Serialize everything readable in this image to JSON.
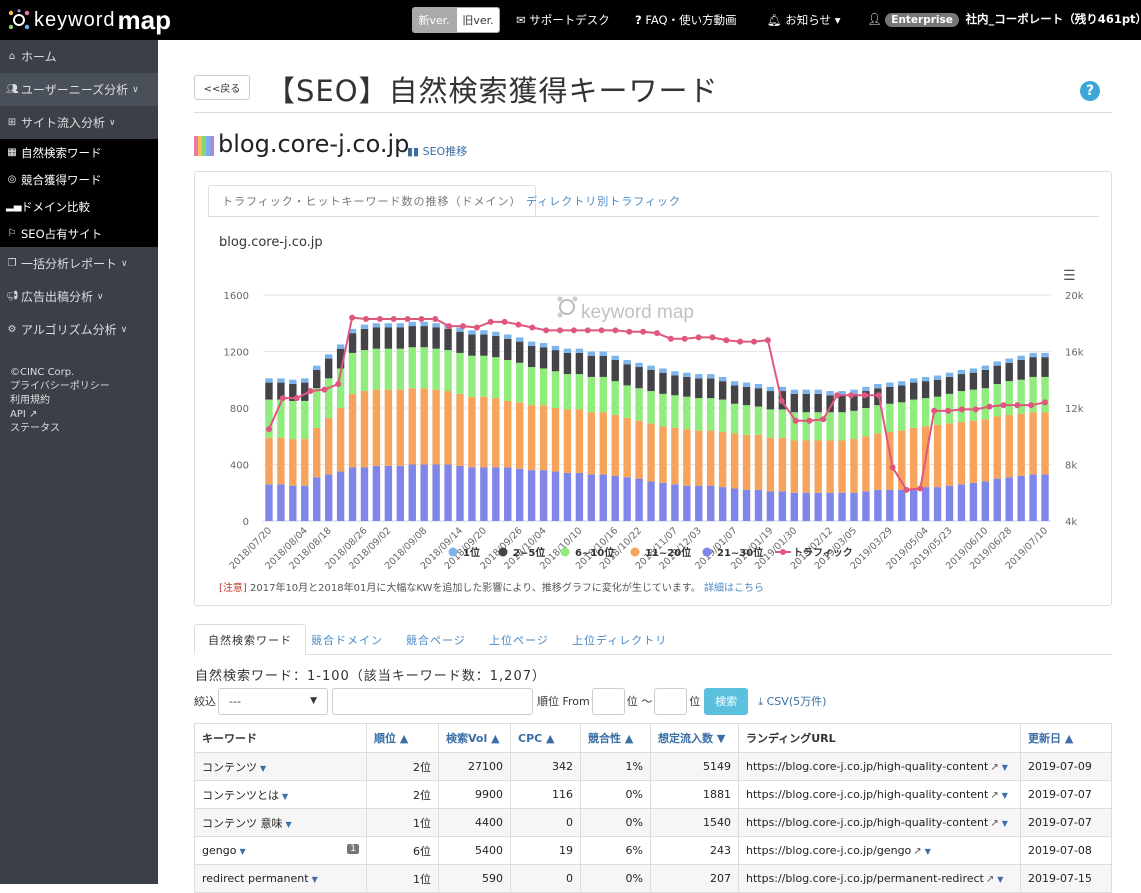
{
  "topbar": {
    "logo_keyword": "keyword",
    "logo_map": "map",
    "new_version": "新ver.",
    "old_version": "旧ver.",
    "support": "サポートデスク",
    "faq": "FAQ・使い方動画",
    "notice": "お知らせ",
    "plan_badge": "Enterprise",
    "account": "社内_コーポレート（残り461pt）"
  },
  "sidebar": {
    "items": [
      {
        "label": "ホーム",
        "icon": "home-icon"
      },
      {
        "label": "ユーザーニーズ分析",
        "icon": "users-icon"
      },
      {
        "label": "サイト流入分析",
        "icon": "sitemap-icon"
      }
    ],
    "subitems": [
      {
        "label": "自然検索ワード",
        "icon": "table-icon"
      },
      {
        "label": "競合獲得ワード",
        "icon": "target-icon"
      },
      {
        "label": "ドメイン比較",
        "icon": "signal-icon"
      },
      {
        "label": "SEO占有サイト",
        "icon": "flag-icon"
      }
    ],
    "items2": [
      {
        "label": "一括分析レポート",
        "icon": "copy-icon"
      },
      {
        "label": "広告出稿分析",
        "icon": "bullhorn-icon"
      },
      {
        "label": "アルゴリズム分析",
        "icon": "cogs-icon"
      }
    ],
    "footer": {
      "copyright": "©CINC Corp.",
      "privacy": "プライバシーポリシー",
      "terms": "利用規約",
      "api": "API",
      "status": "ステータス"
    }
  },
  "page": {
    "back_label": "<<戻る",
    "title": "【SEO】自然検索獲得キーワード",
    "help": "?",
    "domain": "blog.core-j.co.jp",
    "seo_link": "SEO推移"
  },
  "chart_tabs": {
    "tab1": "トラフィック・ヒットキーワード数の推移（ドメイン）",
    "tab2": "ディレクトリ別トラフィック"
  },
  "chart_data": {
    "type": "bar",
    "title": "blog.core-j.co.jp",
    "watermark": "keyword map",
    "stacked": true,
    "y_left_ticks": [
      "0",
      "400",
      "800",
      "1200",
      "1600"
    ],
    "y_right_ticks": [
      "4k",
      "8k",
      "12k",
      "16k",
      "20k"
    ],
    "ylim": [
      0,
      1600
    ],
    "y2lim": [
      4000,
      20000
    ],
    "x_ticks": [
      "2018/07/20",
      "2018/08/04",
      "2018/08/18",
      "2018/08/26",
      "2018/09/02",
      "2018/09/08",
      "2018/09/14",
      "2018/09/20",
      "2018/09/26",
      "2018/10/04",
      "2018/10/10",
      "2018/10/16",
      "2018/10/22",
      "2018/11/07",
      "2018/12/03",
      "2019/01/07",
      "2019/01/19",
      "2019/01/30",
      "2019/02/12",
      "2019/03/05",
      "2019/03/29",
      "2019/05/04",
      "2019/05/23",
      "2019/06/10",
      "2019/06/28",
      "2019/07/10"
    ],
    "series": [
      {
        "name": "1位",
        "color": "#7cb5ec",
        "values": [
          30,
          30,
          30,
          30,
          30,
          30,
          30,
          30,
          30,
          30,
          30,
          30,
          30,
          30,
          30,
          30,
          30,
          30,
          30,
          30,
          30,
          30,
          30,
          30,
          30,
          30,
          30,
          30,
          30,
          30,
          30,
          30,
          30,
          30,
          30,
          30,
          30,
          30,
          30,
          30,
          30,
          30,
          30,
          30,
          30,
          30,
          30,
          30,
          30,
          30,
          30,
          30,
          30,
          30,
          30,
          30,
          30,
          30,
          30,
          30,
          30,
          30,
          30,
          30,
          30,
          30
        ]
      },
      {
        "name": "2~5位",
        "color": "#434348",
        "values": [
          120,
          120,
          120,
          130,
          130,
          140,
          140,
          140,
          150,
          150,
          150,
          150,
          150,
          150,
          150,
          150,
          150,
          150,
          150,
          150,
          150,
          150,
          150,
          150,
          150,
          150,
          150,
          150,
          150,
          150,
          150,
          150,
          150,
          150,
          140,
          140,
          140,
          140,
          130,
          130,
          130,
          130,
          130,
          130,
          130,
          130,
          130,
          120,
          120,
          120,
          120,
          120,
          120,
          120,
          120,
          120,
          120,
          120,
          120,
          120,
          130,
          130,
          130,
          140,
          140,
          140
        ]
      },
      {
        "name": "6~10位",
        "color": "#90ed7d",
        "values": [
          270,
          270,
          270,
          270,
          280,
          280,
          280,
          290,
          290,
          290,
          290,
          290,
          290,
          290,
          290,
          290,
          290,
          290,
          290,
          290,
          290,
          280,
          270,
          260,
          260,
          250,
          250,
          250,
          250,
          240,
          230,
          230,
          230,
          230,
          230,
          230,
          230,
          230,
          230,
          210,
          210,
          200,
          200,
          200,
          200,
          200,
          200,
          200,
          200,
          200,
          200,
          200,
          200,
          200,
          200,
          200,
          200,
          210,
          220,
          220,
          220,
          230,
          240,
          240,
          250,
          250
        ]
      },
      {
        "name": "11~20位",
        "color": "#f7a35c",
        "values": [
          330,
          330,
          330,
          330,
          350,
          400,
          450,
          520,
          540,
          540,
          540,
          540,
          540,
          540,
          530,
          520,
          510,
          500,
          500,
          490,
          470,
          470,
          460,
          460,
          450,
          450,
          450,
          440,
          440,
          430,
          420,
          410,
          410,
          400,
          400,
          400,
          390,
          390,
          390,
          390,
          390,
          390,
          380,
          380,
          370,
          370,
          370,
          370,
          370,
          380,
          390,
          400,
          410,
          420,
          430,
          430,
          440,
          440,
          440,
          440,
          440,
          440,
          440,
          440,
          440,
          440
        ]
      },
      {
        "name": "21~30位",
        "color": "#8085e9",
        "values": [
          260,
          260,
          250,
          250,
          310,
          330,
          350,
          380,
          380,
          390,
          390,
          390,
          400,
          400,
          400,
          400,
          390,
          380,
          380,
          380,
          380,
          370,
          360,
          360,
          350,
          340,
          340,
          330,
          330,
          320,
          310,
          300,
          280,
          270,
          260,
          250,
          250,
          250,
          240,
          230,
          220,
          220,
          210,
          210,
          200,
          200,
          200,
          200,
          200,
          200,
          210,
          220,
          220,
          220,
          230,
          240,
          240,
          250,
          260,
          270,
          280,
          300,
          310,
          320,
          330,
          330
        ]
      },
      {
        "name": "トラフィック",
        "color": "#e0577e",
        "values": [
          10500,
          12700,
          12700,
          13200,
          13300,
          13700,
          18400,
          18300,
          18300,
          18300,
          18300,
          18300,
          18300,
          17800,
          17800,
          17700,
          18100,
          18100,
          17900,
          17700,
          17500,
          17500,
          17500,
          17500,
          17500,
          17500,
          17400,
          17400,
          17300,
          16900,
          16900,
          17000,
          17000,
          16800,
          16700,
          16700,
          16800,
          12500,
          11100,
          11100,
          11200,
          12900,
          12900,
          12900,
          12900,
          7800,
          6200,
          6300,
          11800,
          11800,
          11900,
          11900,
          12100,
          12200,
          12200,
          12200,
          12400
        ]
      }
    ],
    "legend_position": "bottom"
  },
  "chart_note": {
    "warn": "[注意]",
    "text": "2017年10月と2018年01月に大幅なKWを追加した影響により、推移グラフに変化が生じています。",
    "link": "詳細はこちら"
  },
  "bottom_tabs": [
    "自然検索ワード",
    "競合ドメイン",
    "競合ページ",
    "上位ページ",
    "上位ディレクトリ"
  ],
  "results": {
    "count_text": "自然検索ワード：1-100（該当キーワード数：1,207）"
  },
  "filter": {
    "narrow_label": "絞込",
    "select_value": "---",
    "keyword_value": "",
    "rank_from_label": "順位 From",
    "unit1": "位 ～",
    "unit2": "位",
    "search_label": "検索",
    "csv_label": "CSV(5万件)"
  },
  "table": {
    "headers": [
      "キーワード",
      "順位 ▲",
      "検索Vol ▲",
      "CPC ▲",
      "競合性 ▲",
      "想定流入数 ▼",
      "ランディングURL",
      "更新日 ▲"
    ],
    "rows": [
      {
        "keyword": "コンテンツ",
        "badge": "",
        "rank": "2位",
        "vol": "27100",
        "cpc": "342",
        "comp": "1%",
        "traffic": "5149",
        "url": "https://blog.core-j.co.jp/high-quality-content",
        "date": "2019-07-09"
      },
      {
        "keyword": "コンテンツとは",
        "badge": "",
        "rank": "2位",
        "vol": "9900",
        "cpc": "116",
        "comp": "0%",
        "traffic": "1881",
        "url": "https://blog.core-j.co.jp/high-quality-content",
        "date": "2019-07-07"
      },
      {
        "keyword": "コンテンツ 意味",
        "badge": "",
        "rank": "1位",
        "vol": "4400",
        "cpc": "0",
        "comp": "0%",
        "traffic": "1540",
        "url": "https://blog.core-j.co.jp/high-quality-content",
        "date": "2019-07-07"
      },
      {
        "keyword": "gengo",
        "badge": "1",
        "rank": "6位",
        "vol": "5400",
        "cpc": "19",
        "comp": "6%",
        "traffic": "243",
        "url": "https://blog.core-j.co.jp/gengo",
        "date": "2019-07-08"
      },
      {
        "keyword": "redirect permanent",
        "badge": "",
        "rank": "1位",
        "vol": "590",
        "cpc": "0",
        "comp": "0%",
        "traffic": "207",
        "url": "https://blog.core-j.co.jp/permanent-redirect",
        "date": "2019-07-15"
      }
    ]
  }
}
